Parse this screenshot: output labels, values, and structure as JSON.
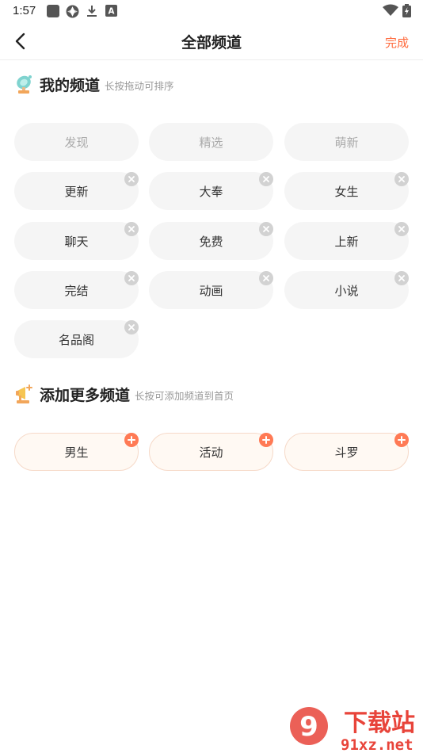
{
  "status_bar": {
    "time": "1:57"
  },
  "header": {
    "title": "全部频道",
    "done_label": "完成"
  },
  "my_channels": {
    "title": "我的频道",
    "hint": "长按拖动可排序",
    "fixed": [
      "发现",
      "精选",
      "萌新"
    ],
    "removable": [
      "更新",
      "大奉",
      "女生",
      "聊天",
      "免费",
      "上新",
      "完结",
      "动画",
      "小说",
      "名品阁"
    ]
  },
  "more_channels": {
    "title": "添加更多频道",
    "hint": "长按可添加频道到首页",
    "items": [
      "男生",
      "活动",
      "斗罗"
    ]
  },
  "watermark": {
    "brand": "下载站",
    "domain": "91xz.net"
  },
  "colors": {
    "accent": "#ff6a3d",
    "chip_bg": "#f5f5f5",
    "add_chip_bg": "#fff9f3",
    "remove_badge": "#d2d2d2",
    "add_badge": "#ff7a55"
  }
}
